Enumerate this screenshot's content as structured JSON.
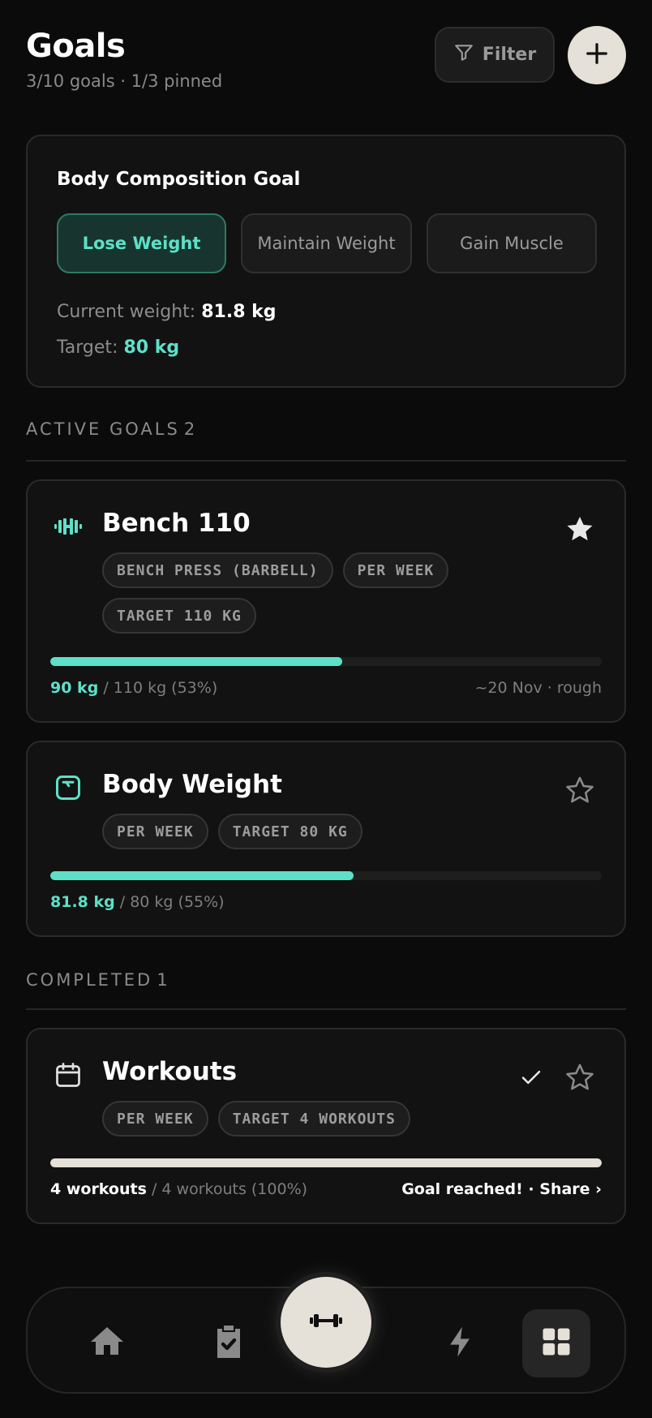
{
  "header": {
    "title": "Goals",
    "subtitle": "3/10 goals · 1/3 pinned",
    "filter_label": "Filter",
    "add_icon": "plus-icon",
    "filter_icon": "funnel-icon"
  },
  "body_composition": {
    "title": "Body Composition Goal",
    "options": [
      {
        "label": "Lose Weight",
        "selected": true
      },
      {
        "label": "Maintain Weight",
        "selected": false
      },
      {
        "label": "Gain Muscle",
        "selected": false
      }
    ],
    "current_label": "Current weight:",
    "current_value": "81.8 kg",
    "target_label": "Target:",
    "target_value": "80 kg"
  },
  "sections": {
    "active": {
      "label": "ACTIVE GOALS",
      "count": "2"
    },
    "completed": {
      "label": "COMPLETED",
      "count": "1"
    }
  },
  "goals": [
    {
      "title": "Bench 110",
      "icon": "dumbbell-icon",
      "pinned": true,
      "chips": [
        "BENCH PRESS (BARBELL)",
        "PER WEEK",
        "TARGET 110 KG"
      ],
      "progress": 0.53,
      "current": "90 kg",
      "rest": " / 110 kg (53%)",
      "right_text": "~20 Nov · rough"
    },
    {
      "title": "Body Weight",
      "icon": "scale-icon",
      "pinned": false,
      "chips": [
        "PER WEEK",
        "TARGET 80 KG"
      ],
      "progress": 0.55,
      "current": "81.8 kg",
      "rest": " / 80 kg (55%)"
    },
    {
      "title": "Workouts",
      "icon": "calendar-icon",
      "pinned": false,
      "completed": true,
      "chips": [
        "PER WEEK",
        "TARGET 4 WORKOUTS"
      ],
      "progress": 1.0,
      "current": "4 workouts",
      "rest": " / 4 workouts (100%)",
      "right_text": "Goal reached! · Share ›"
    }
  ],
  "bottom_nav": {
    "items": [
      "home-icon",
      "clipboard-check-icon",
      "dumbbell-icon",
      "lightning-icon",
      "grid-icon"
    ],
    "selected": "grid-icon"
  },
  "colors": {
    "accent": "#5ee0c8",
    "cream": "#e5e0d8",
    "background": "#0b0b0b",
    "card": "#121212"
  }
}
